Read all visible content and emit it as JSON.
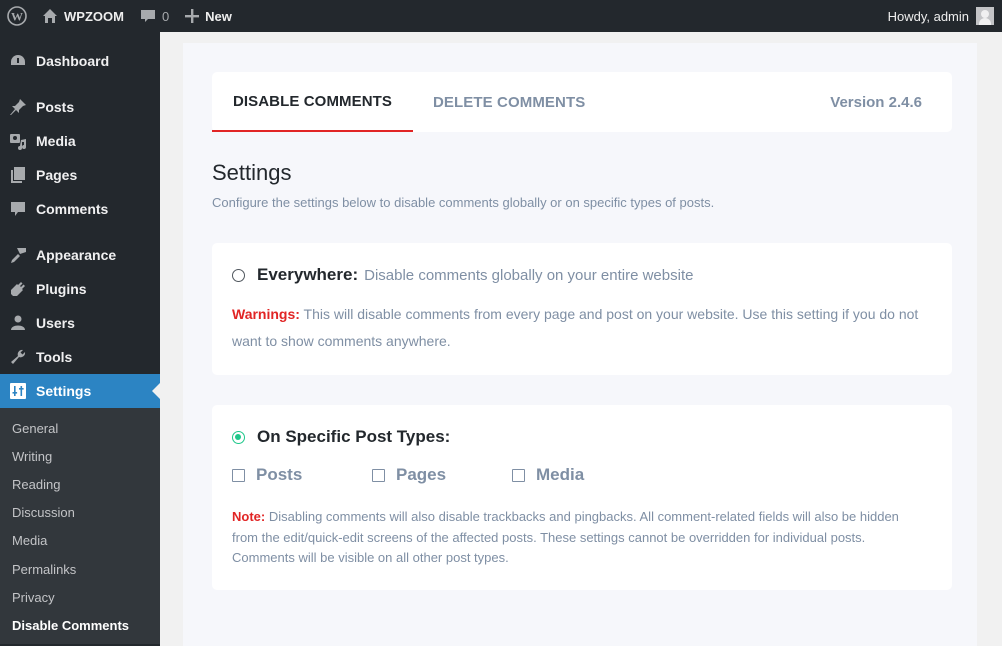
{
  "adminbar": {
    "site_name": "WPZOOM",
    "comments_count": "0",
    "new_label": "New",
    "howdy": "Howdy, admin"
  },
  "sidebar": {
    "items": [
      {
        "label": "Dashboard",
        "icon": "dashboard-icon"
      },
      {
        "label": "Posts",
        "icon": "pin-icon"
      },
      {
        "label": "Media",
        "icon": "media-icon"
      },
      {
        "label": "Pages",
        "icon": "pages-icon"
      },
      {
        "label": "Comments",
        "icon": "comment-icon"
      },
      {
        "label": "Appearance",
        "icon": "brush-icon"
      },
      {
        "label": "Plugins",
        "icon": "plug-icon"
      },
      {
        "label": "Users",
        "icon": "user-icon"
      },
      {
        "label": "Tools",
        "icon": "wrench-icon"
      },
      {
        "label": "Settings",
        "icon": "sliders-icon",
        "active": true
      }
    ],
    "submenu": [
      "General",
      "Writing",
      "Reading",
      "Discussion",
      "Media",
      "Permalinks",
      "Privacy",
      "Disable Comments"
    ],
    "submenu_current": "Disable Comments"
  },
  "plugin": {
    "tabs": [
      {
        "label": "DISABLE COMMENTS",
        "active": true
      },
      {
        "label": "DELETE COMMENTS",
        "active": false
      }
    ],
    "version": "Version 2.4.6",
    "title": "Settings",
    "description": "Configure the settings below to disable comments globally or on specific types of posts.",
    "everywhere": {
      "label": "Everywhere:",
      "desc": "Disable comments globally on your entire website",
      "selected": false,
      "warning_label": "Warnings:",
      "warning_text": " This will disable comments from every page and post on your website. Use this setting if you do not want to show comments anywhere."
    },
    "specific": {
      "label": "On Specific Post Types:",
      "selected": true,
      "post_types": [
        {
          "label": "Posts",
          "checked": false
        },
        {
          "label": "Pages",
          "checked": false
        },
        {
          "label": "Media",
          "checked": false
        }
      ],
      "note_label": "Note:",
      "note_text": " Disabling comments will also disable trackbacks and pingbacks. All comment-related fields will also be hidden from the edit/quick-edit screens of the affected posts. These settings cannot be overridden for individual posts. Comments will be visible on all other post types."
    },
    "colors": {
      "accent_red": "#e12525",
      "radio_green": "#1ec78a",
      "wp_blue": "#2c84c3"
    }
  }
}
